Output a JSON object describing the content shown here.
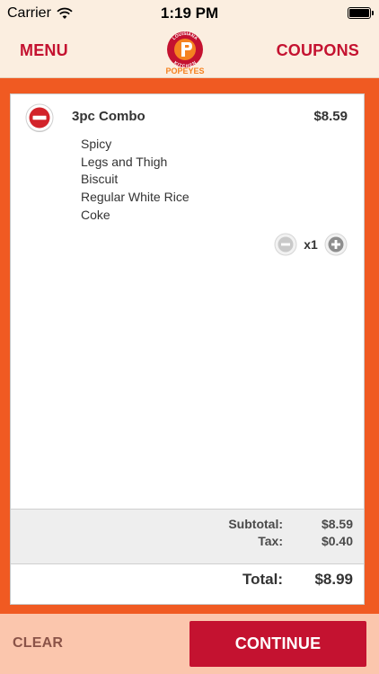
{
  "status_bar": {
    "carrier": "Carrier",
    "time": "1:19 PM"
  },
  "nav": {
    "menu_label": "MENU",
    "coupons_label": "COUPONS",
    "logo": {
      "name": "popeyes-logo",
      "arc_top": "LOUISIANA",
      "arc_bottom": "KITCHEN",
      "wordmark": "POPEYES"
    }
  },
  "cart": {
    "items": [
      {
        "name": "3pc Combo",
        "price": "$8.59",
        "modifiers": [
          "Spicy",
          "Legs and Thigh",
          "Biscuit",
          "Regular White Rice",
          "Coke"
        ],
        "quantity": "x1"
      }
    ],
    "subtotal_label": "Subtotal:",
    "subtotal": "$8.59",
    "tax_label": "Tax:",
    "tax": "$0.40",
    "total_label": "Total:",
    "total": "$8.99"
  },
  "actions": {
    "clear_label": "CLEAR",
    "continue_label": "CONTINUE"
  },
  "colors": {
    "brand_red": "#c41230",
    "brand_orange": "#f05a22",
    "nav_bg": "#fbeee0",
    "bottom_bg": "#fbc6ad"
  },
  "icons": {
    "remove": "remove-item-icon",
    "decrease": "minus-circle-icon",
    "increase": "plus-circle-icon",
    "wifi": "wifi-icon",
    "battery": "battery-icon"
  }
}
